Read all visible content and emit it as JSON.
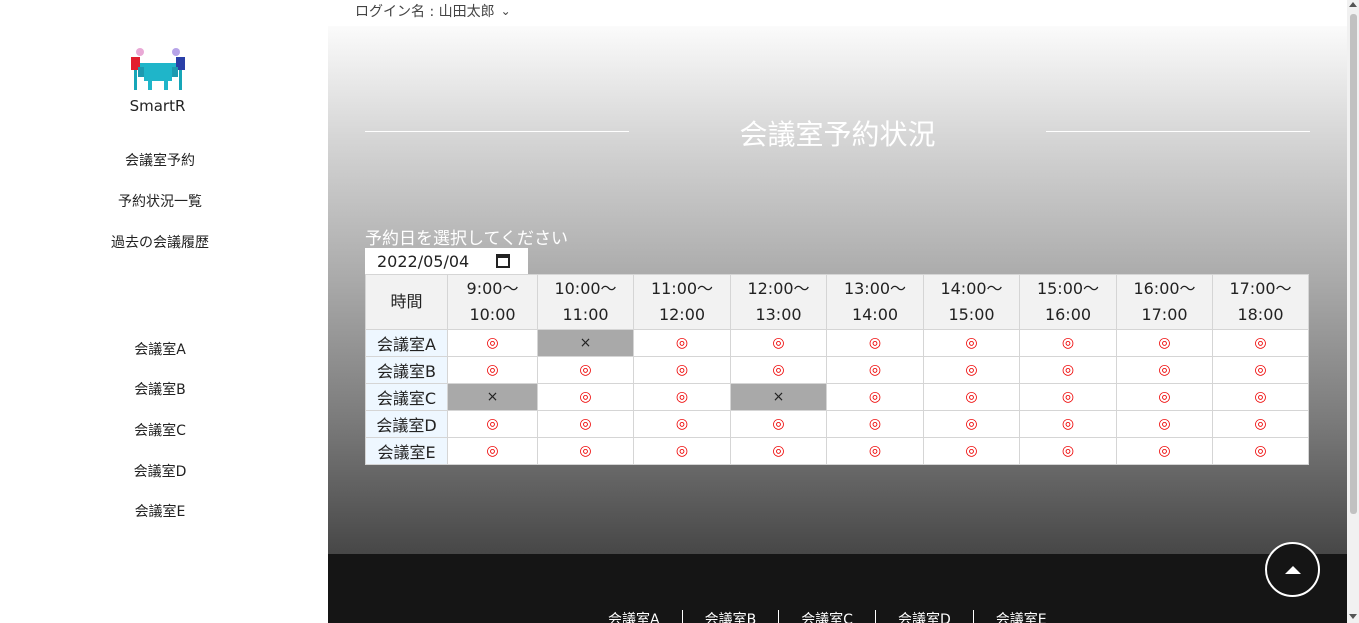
{
  "user_menu": {
    "label": "ログイン名 : 山田太郎",
    "chevron_icon": "chevron-down-icon"
  },
  "sidebar": {
    "brand": "SmartR",
    "logo_icon": "meeting-logo-icon",
    "menu": [
      {
        "label": "会議室予約"
      },
      {
        "label": "予約状況一覧"
      },
      {
        "label": "過去の会議履歴"
      }
    ],
    "rooms": [
      {
        "label": "会議室A"
      },
      {
        "label": "会議室B"
      },
      {
        "label": "会議室C"
      },
      {
        "label": "会議室D"
      },
      {
        "label": "会議室E"
      }
    ]
  },
  "main": {
    "title": "会議室予約状況",
    "date_label": "予約日を選択してください",
    "date_value": "2022/05/04",
    "calendar_icon": "calendar-icon"
  },
  "table": {
    "time_header": "時間",
    "slots": [
      {
        "start": "9:00～",
        "end": "10:00"
      },
      {
        "start": "10:00～",
        "end": "11:00"
      },
      {
        "start": "11:00～",
        "end": "12:00"
      },
      {
        "start": "12:00～",
        "end": "13:00"
      },
      {
        "start": "13:00～",
        "end": "14:00"
      },
      {
        "start": "14:00～",
        "end": "15:00"
      },
      {
        "start": "15:00～",
        "end": "16:00"
      },
      {
        "start": "16:00～",
        "end": "17:00"
      },
      {
        "start": "17:00～",
        "end": "18:00"
      }
    ],
    "rows": [
      {
        "room": "会議室A",
        "cells": [
          "◎",
          "×",
          "◎",
          "◎",
          "◎",
          "◎",
          "◎",
          "◎",
          "◎"
        ]
      },
      {
        "room": "会議室B",
        "cells": [
          "◎",
          "◎",
          "◎",
          "◎",
          "◎",
          "◎",
          "◎",
          "◎",
          "◎"
        ]
      },
      {
        "room": "会議室C",
        "cells": [
          "×",
          "◎",
          "◎",
          "×",
          "◎",
          "◎",
          "◎",
          "◎",
          "◎"
        ]
      },
      {
        "room": "会議室D",
        "cells": [
          "◎",
          "◎",
          "◎",
          "◎",
          "◎",
          "◎",
          "◎",
          "◎",
          "◎"
        ]
      },
      {
        "room": "会議室E",
        "cells": [
          "◎",
          "◎",
          "◎",
          "◎",
          "◎",
          "◎",
          "◎",
          "◎",
          "◎"
        ]
      }
    ]
  },
  "footer": {
    "links": [
      {
        "label": "会議室A"
      },
      {
        "label": "会議室B"
      },
      {
        "label": "会議室C"
      },
      {
        "label": "会議室D"
      },
      {
        "label": "会議室E"
      }
    ],
    "to_top_icon": "arrow-up-icon"
  },
  "colors": {
    "available": "#e00000",
    "unavailable_bg": "#a9a9a9",
    "footer_bg": "#151515",
    "room_header_bg": "#eef7ff"
  }
}
